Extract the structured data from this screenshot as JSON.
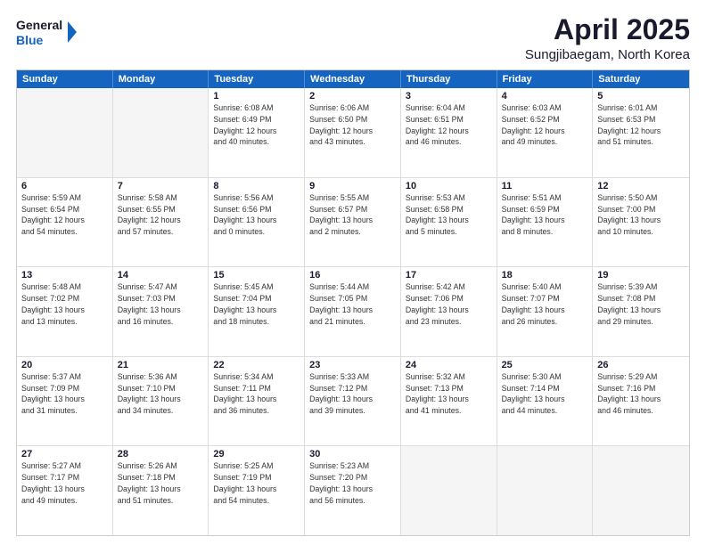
{
  "header": {
    "logo_general": "General",
    "logo_blue": "Blue",
    "month": "April 2025",
    "location": "Sungjibaegam, North Korea"
  },
  "weekdays": [
    "Sunday",
    "Monday",
    "Tuesday",
    "Wednesday",
    "Thursday",
    "Friday",
    "Saturday"
  ],
  "rows": [
    [
      {
        "day": "",
        "info": ""
      },
      {
        "day": "",
        "info": ""
      },
      {
        "day": "1",
        "info": "Sunrise: 6:08 AM\nSunset: 6:49 PM\nDaylight: 12 hours\nand 40 minutes."
      },
      {
        "day": "2",
        "info": "Sunrise: 6:06 AM\nSunset: 6:50 PM\nDaylight: 12 hours\nand 43 minutes."
      },
      {
        "day": "3",
        "info": "Sunrise: 6:04 AM\nSunset: 6:51 PM\nDaylight: 12 hours\nand 46 minutes."
      },
      {
        "day": "4",
        "info": "Sunrise: 6:03 AM\nSunset: 6:52 PM\nDaylight: 12 hours\nand 49 minutes."
      },
      {
        "day": "5",
        "info": "Sunrise: 6:01 AM\nSunset: 6:53 PM\nDaylight: 12 hours\nand 51 minutes."
      }
    ],
    [
      {
        "day": "6",
        "info": "Sunrise: 5:59 AM\nSunset: 6:54 PM\nDaylight: 12 hours\nand 54 minutes."
      },
      {
        "day": "7",
        "info": "Sunrise: 5:58 AM\nSunset: 6:55 PM\nDaylight: 12 hours\nand 57 minutes."
      },
      {
        "day": "8",
        "info": "Sunrise: 5:56 AM\nSunset: 6:56 PM\nDaylight: 13 hours\nand 0 minutes."
      },
      {
        "day": "9",
        "info": "Sunrise: 5:55 AM\nSunset: 6:57 PM\nDaylight: 13 hours\nand 2 minutes."
      },
      {
        "day": "10",
        "info": "Sunrise: 5:53 AM\nSunset: 6:58 PM\nDaylight: 13 hours\nand 5 minutes."
      },
      {
        "day": "11",
        "info": "Sunrise: 5:51 AM\nSunset: 6:59 PM\nDaylight: 13 hours\nand 8 minutes."
      },
      {
        "day": "12",
        "info": "Sunrise: 5:50 AM\nSunset: 7:00 PM\nDaylight: 13 hours\nand 10 minutes."
      }
    ],
    [
      {
        "day": "13",
        "info": "Sunrise: 5:48 AM\nSunset: 7:02 PM\nDaylight: 13 hours\nand 13 minutes."
      },
      {
        "day": "14",
        "info": "Sunrise: 5:47 AM\nSunset: 7:03 PM\nDaylight: 13 hours\nand 16 minutes."
      },
      {
        "day": "15",
        "info": "Sunrise: 5:45 AM\nSunset: 7:04 PM\nDaylight: 13 hours\nand 18 minutes."
      },
      {
        "day": "16",
        "info": "Sunrise: 5:44 AM\nSunset: 7:05 PM\nDaylight: 13 hours\nand 21 minutes."
      },
      {
        "day": "17",
        "info": "Sunrise: 5:42 AM\nSunset: 7:06 PM\nDaylight: 13 hours\nand 23 minutes."
      },
      {
        "day": "18",
        "info": "Sunrise: 5:40 AM\nSunset: 7:07 PM\nDaylight: 13 hours\nand 26 minutes."
      },
      {
        "day": "19",
        "info": "Sunrise: 5:39 AM\nSunset: 7:08 PM\nDaylight: 13 hours\nand 29 minutes."
      }
    ],
    [
      {
        "day": "20",
        "info": "Sunrise: 5:37 AM\nSunset: 7:09 PM\nDaylight: 13 hours\nand 31 minutes."
      },
      {
        "day": "21",
        "info": "Sunrise: 5:36 AM\nSunset: 7:10 PM\nDaylight: 13 hours\nand 34 minutes."
      },
      {
        "day": "22",
        "info": "Sunrise: 5:34 AM\nSunset: 7:11 PM\nDaylight: 13 hours\nand 36 minutes."
      },
      {
        "day": "23",
        "info": "Sunrise: 5:33 AM\nSunset: 7:12 PM\nDaylight: 13 hours\nand 39 minutes."
      },
      {
        "day": "24",
        "info": "Sunrise: 5:32 AM\nSunset: 7:13 PM\nDaylight: 13 hours\nand 41 minutes."
      },
      {
        "day": "25",
        "info": "Sunrise: 5:30 AM\nSunset: 7:14 PM\nDaylight: 13 hours\nand 44 minutes."
      },
      {
        "day": "26",
        "info": "Sunrise: 5:29 AM\nSunset: 7:16 PM\nDaylight: 13 hours\nand 46 minutes."
      }
    ],
    [
      {
        "day": "27",
        "info": "Sunrise: 5:27 AM\nSunset: 7:17 PM\nDaylight: 13 hours\nand 49 minutes."
      },
      {
        "day": "28",
        "info": "Sunrise: 5:26 AM\nSunset: 7:18 PM\nDaylight: 13 hours\nand 51 minutes."
      },
      {
        "day": "29",
        "info": "Sunrise: 5:25 AM\nSunset: 7:19 PM\nDaylight: 13 hours\nand 54 minutes."
      },
      {
        "day": "30",
        "info": "Sunrise: 5:23 AM\nSunset: 7:20 PM\nDaylight: 13 hours\nand 56 minutes."
      },
      {
        "day": "",
        "info": ""
      },
      {
        "day": "",
        "info": ""
      },
      {
        "day": "",
        "info": ""
      }
    ]
  ]
}
